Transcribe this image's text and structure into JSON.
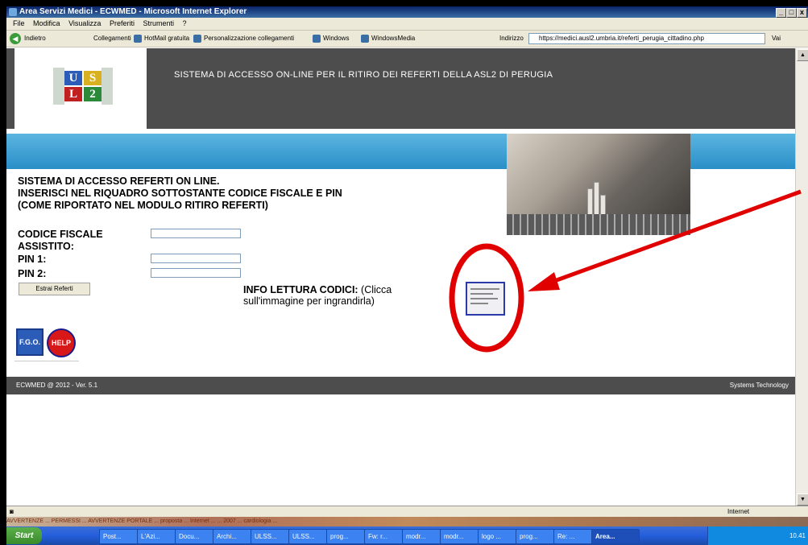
{
  "window": {
    "title": "Area Servizi Medici - ECWMED - Microsoft Internet Explorer"
  },
  "menubar": {
    "items": [
      "File",
      "Modifica",
      "Visualizza",
      "Preferiti",
      "Strumenti",
      "?"
    ]
  },
  "toolbar": {
    "back_label": "Indietro",
    "links": [
      "Collegamenti",
      "HotMail gratuita",
      "Personalizzazione collegamenti",
      "Windows",
      "WindowsMedia"
    ],
    "address_label": "Indirizzo",
    "address_value": "https://medici.ausl2.umbria.it/referti_perugia_cittadino.php",
    "go_label": "Vai"
  },
  "header": {
    "logo_letters": [
      "U",
      "S",
      "L",
      "2"
    ],
    "title": "SISTEMA DI ACCESSO ON-LINE PER IL RITIRO DEI REFERTI DELLA ASL2 DI PERUGIA"
  },
  "intro": {
    "line1": "SISTEMA DI ACCESSO REFERTI ON LINE.",
    "line2": "INSERISCI NEL RIQUADRO SOTTOSTANTE CODICE FISCALE E PIN",
    "line3": "(COME RIPORTATO NEL MODULO RITIRO REFERTI)"
  },
  "form": {
    "codice_fiscale_label_1": "CODICE FISCALE",
    "codice_fiscale_label_2": "ASSISTITO:",
    "pin1_label": "PIN 1:",
    "pin2_label": "PIN 2:",
    "codice_fiscale_value": "",
    "pin1_value": "",
    "pin2_value": "",
    "submit_label": "Estrai Referti"
  },
  "info": {
    "bold": "INFO LETTURA CODICI:",
    "text1": " (Clicca",
    "text2": "sull'immagine per ingrandirla)"
  },
  "icons": {
    "fgo": "F.G.O.",
    "help": "HELP"
  },
  "footer": {
    "left": "ECWMED @ 2012 - Ver. 5.1",
    "right": "Systems Technology"
  },
  "statusbar": {
    "zone": "Internet"
  },
  "background_strip": "AVVERTENZE ...  PERMESSI ... AVVERTENZE  PORTALE ... proposta ... Internet ... ... 2007 ... cardiologia ...",
  "taskbar": {
    "start_label": "Start",
    "tasks": [
      "Post...",
      "L'Azi...",
      "Docu...",
      "Archi...",
      "ULSS...",
      "ULSS...",
      "prog...",
      "Fw: r...",
      "modr...",
      "modr...",
      "logo ...",
      "prog...",
      "Re: ...",
      "Area..."
    ],
    "clock": "10.41"
  },
  "colors": {
    "header_bg": "#4d4d4d",
    "blue_bar": "#2a8fc8",
    "annotation_red": "#e00000"
  }
}
